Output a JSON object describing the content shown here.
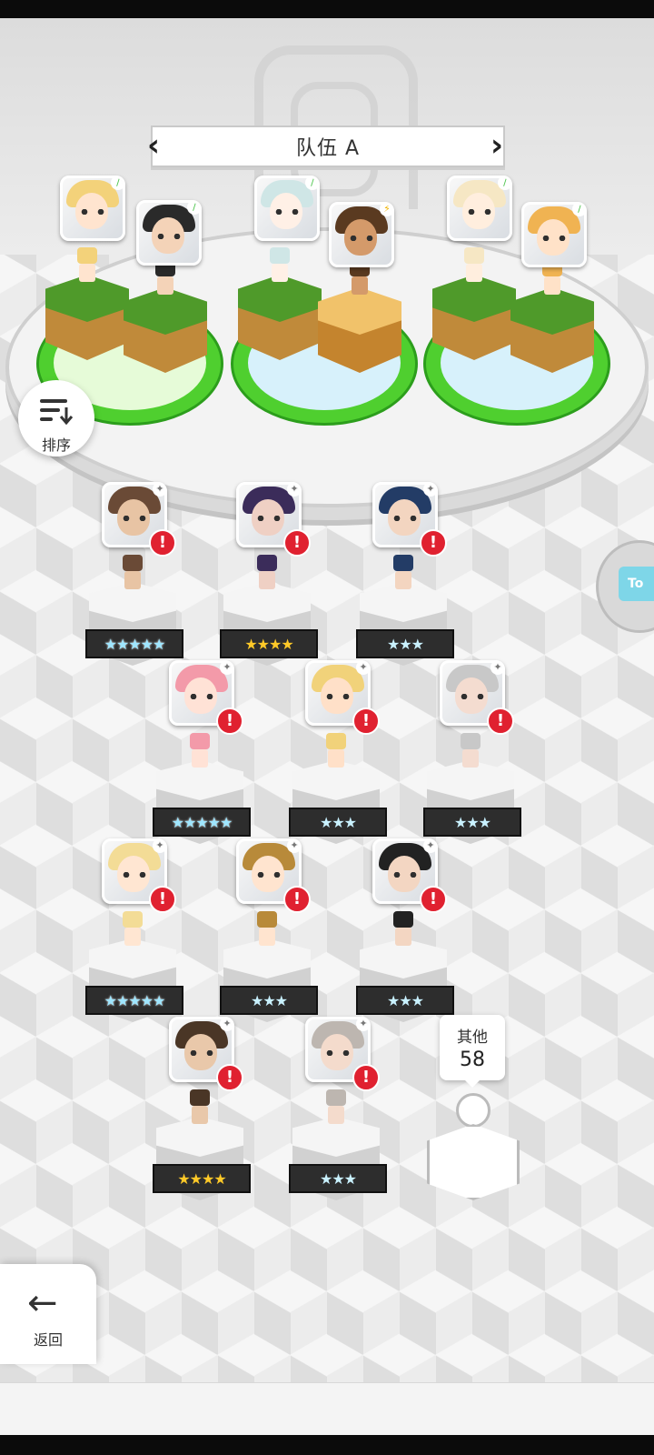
{
  "team": {
    "title": "队伍 A",
    "prev_icon": "chevron-left",
    "next_icon": "chevron-right"
  },
  "sort": {
    "label": "排序",
    "icon": "sort-icon"
  },
  "side_tab": {
    "label": "To"
  },
  "team_members": [
    {
      "hair": "#f3d27a",
      "skin": "#ffe4cf",
      "element": "leaf",
      "badge_color": "#4cc44c"
    },
    {
      "hair": "#2a2a2a",
      "skin": "#f4d3b8",
      "element": "leaf",
      "badge_color": "#4cc44c"
    },
    {
      "hair": "#cfe6e6",
      "skin": "#fff0e6",
      "element": "leaf",
      "badge_color": "#4cc44c"
    },
    {
      "hair": "#5a3a20",
      "skin": "#d49a6a",
      "element": "lightning",
      "badge_color": "#f0b400"
    },
    {
      "hair": "#f6e7c4",
      "skin": "#ffeede",
      "element": "leaf",
      "badge_color": "#4cc44c"
    },
    {
      "hair": "#f0b352",
      "skin": "#ffe2c8",
      "element": "leaf",
      "badge_color": "#4cc44c"
    }
  ],
  "roster": [
    {
      "hair": "#6a4a36",
      "skin": "#e8c4a4",
      "stars": "★★★★★",
      "tier": "rainbow",
      "alert": "!"
    },
    {
      "hair": "#3b2c5a",
      "skin": "#efd0c4",
      "stars": "★★★★",
      "tier": "gold",
      "alert": "!"
    },
    {
      "hair": "#233c66",
      "skin": "#f3d5c0",
      "stars": "★★★",
      "tier": "silver",
      "alert": "!"
    },
    {
      "hair": "#f39aa9",
      "skin": "#ffe2d6",
      "stars": "★★★★★",
      "tier": "rainbow",
      "alert": "!"
    },
    {
      "hair": "#f1d27a",
      "skin": "#ffe0c8",
      "stars": "★★★",
      "tier": "silver",
      "alert": "!"
    },
    {
      "hair": "#c8c8c8",
      "skin": "#f4dcd0",
      "stars": "★★★",
      "tier": "silver",
      "alert": "!"
    },
    {
      "hair": "#f3dc96",
      "skin": "#ffe6d2",
      "stars": "★★★★★",
      "tier": "rainbow",
      "alert": "!"
    },
    {
      "hair": "#b88a3a",
      "skin": "#ffe4cf",
      "stars": "★★★",
      "tier": "silver",
      "alert": "!"
    },
    {
      "hair": "#222222",
      "skin": "#f3d6c2",
      "stars": "★★★",
      "tier": "silver",
      "alert": "!"
    },
    {
      "hair": "#4a3626",
      "skin": "#e9c8aa",
      "stars": "★★★★",
      "tier": "gold",
      "alert": "!"
    },
    {
      "hair": "#bdb6b0",
      "skin": "#f4dbcc",
      "stars": "★★★",
      "tier": "silver",
      "alert": "!"
    }
  ],
  "other": {
    "label": "其他",
    "count": "58"
  },
  "back": {
    "label": "返回",
    "icon": "arrow-left-icon"
  }
}
